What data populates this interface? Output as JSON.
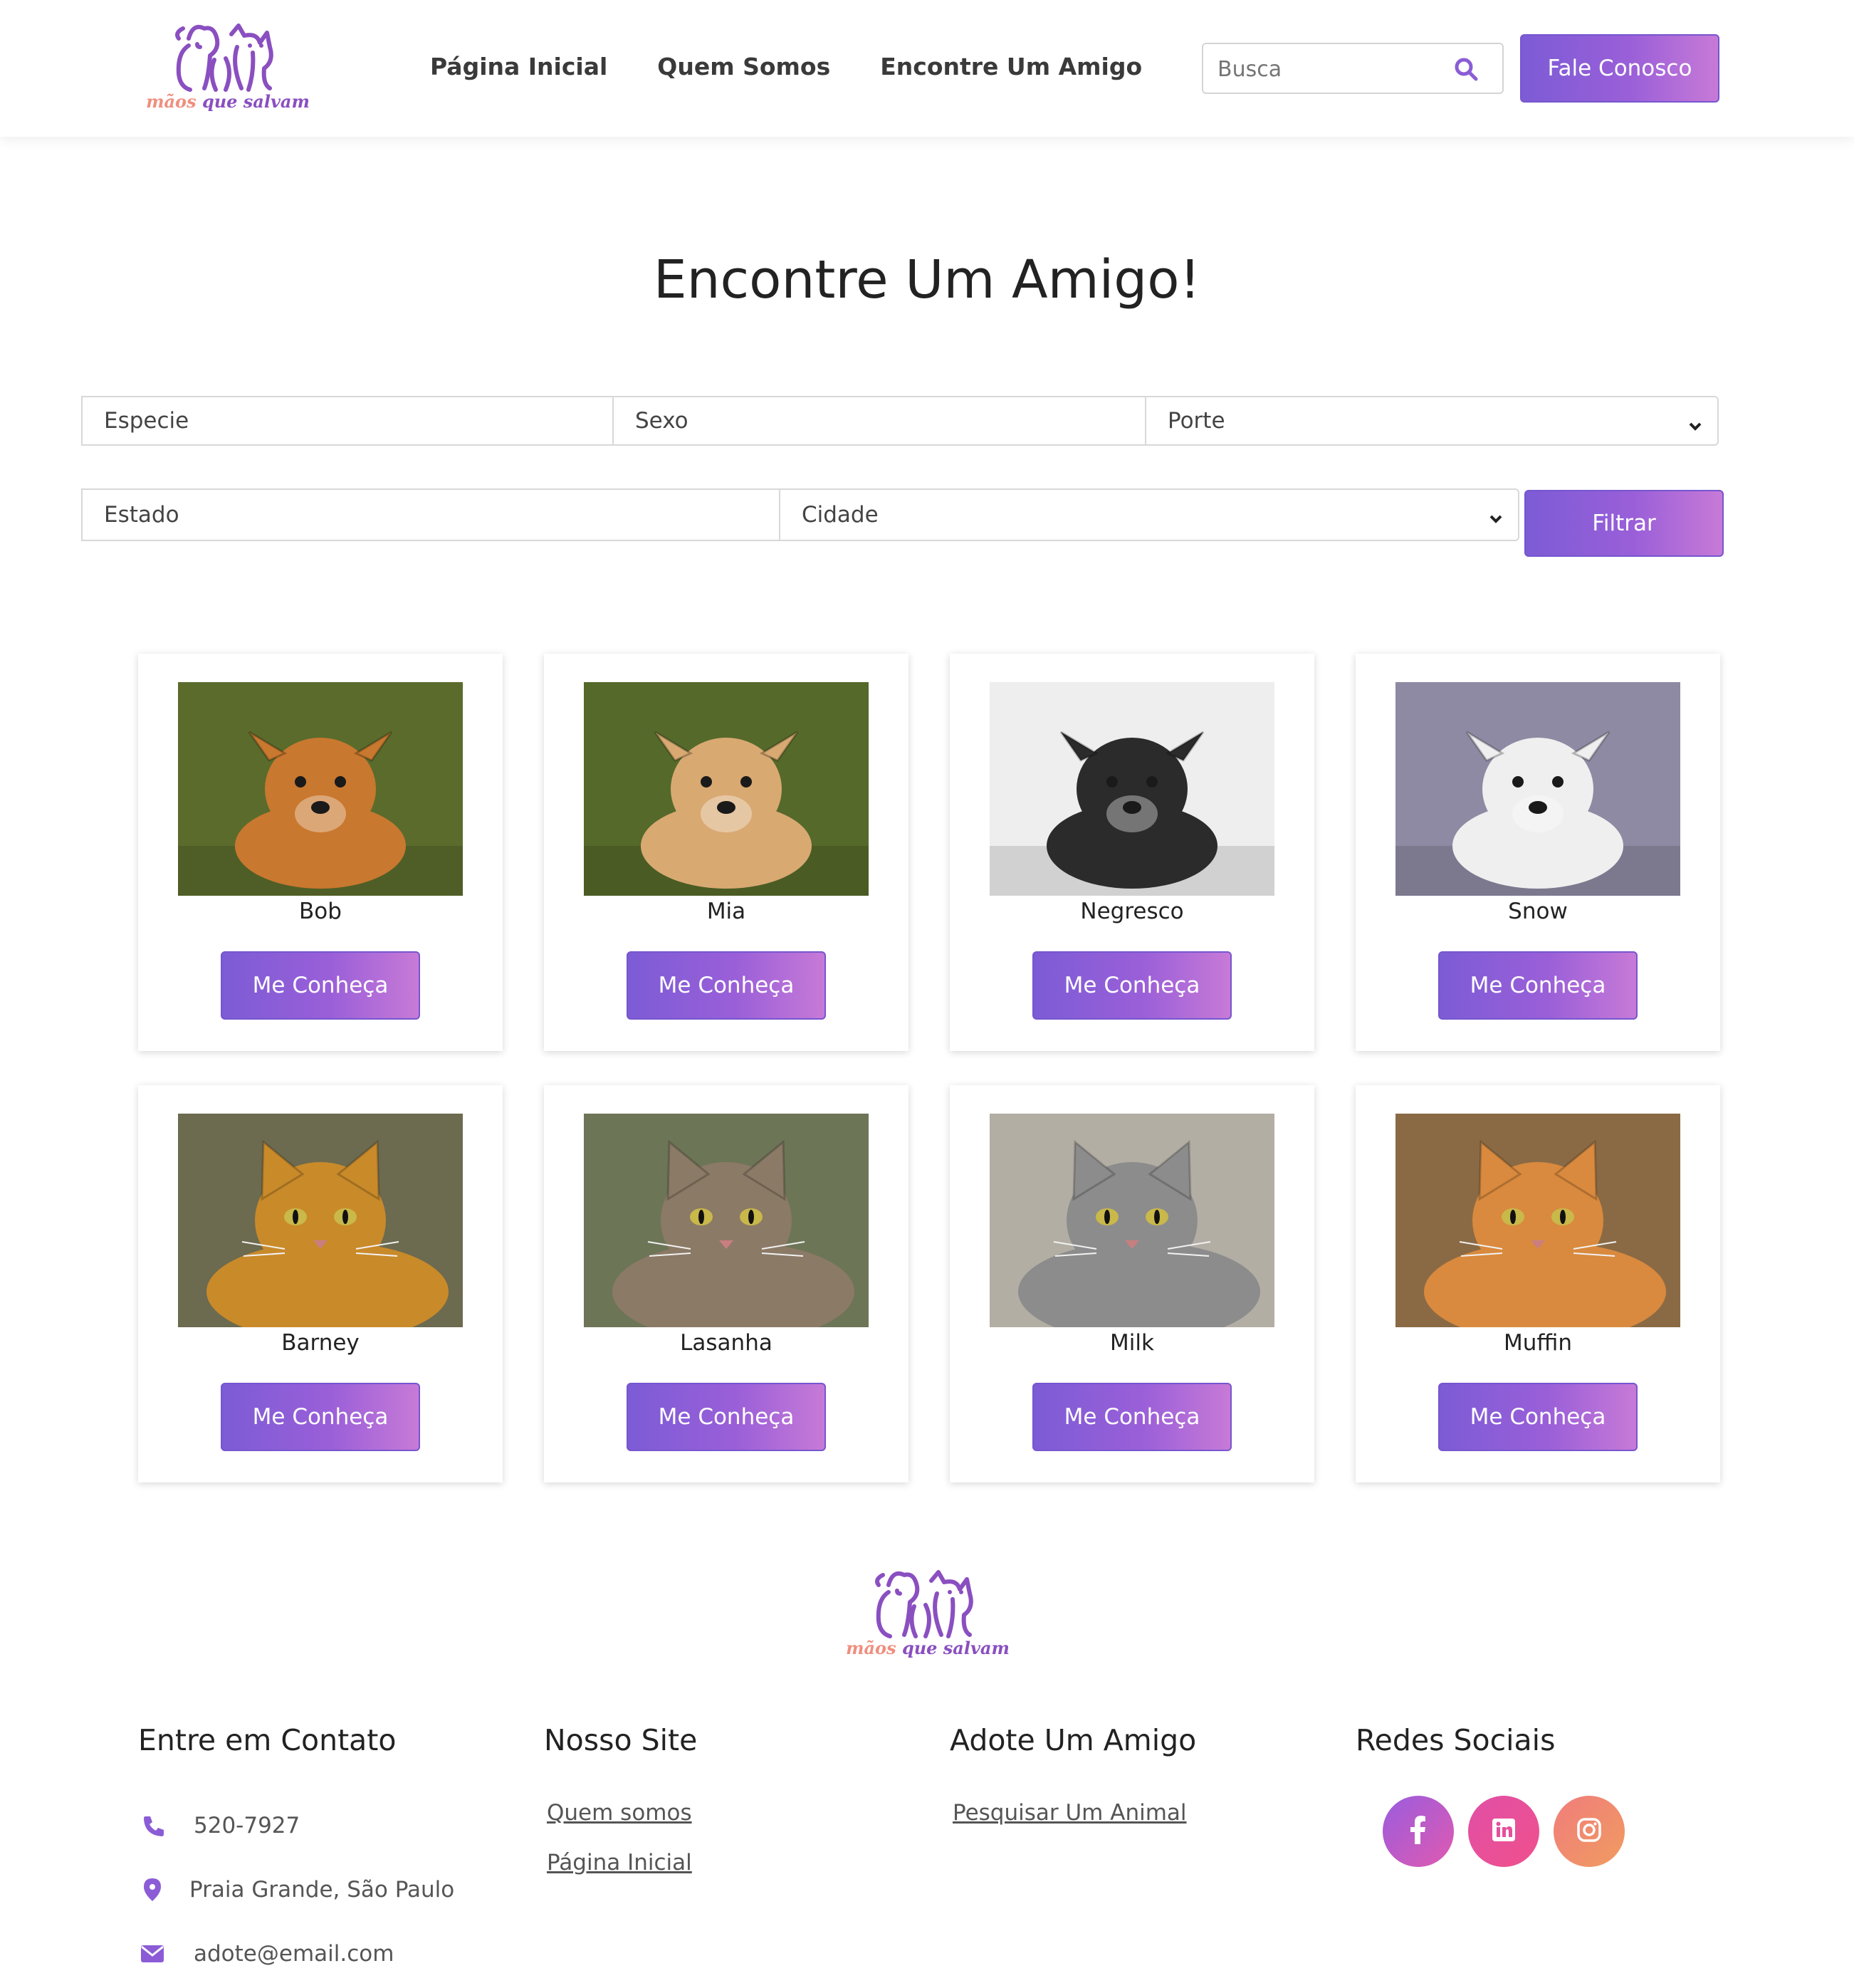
{
  "header": {
    "logo_text_a": "mãos",
    "logo_text_b": "que salvam",
    "nav": [
      "Página Inicial",
      "Quem Somos",
      "Encontre Um Amigo"
    ],
    "search_placeholder": "Busca",
    "contact_button": "Fale Conosco"
  },
  "main": {
    "title": "Encontre Um Amigo!",
    "filters": {
      "especie": "Especie",
      "sexo": "Sexo",
      "porte": "Porte",
      "estado": "Estado",
      "cidade": "Cidade",
      "filter_button": "Filtrar"
    },
    "meet_label": "Me Conheça",
    "animals": [
      {
        "name": "Bob",
        "kind": "dog",
        "bg": "#5a6b2c",
        "coat": "#c9782f"
      },
      {
        "name": "Mia",
        "kind": "dog",
        "bg": "#55692a",
        "coat": "#d9a972"
      },
      {
        "name": "Negresco",
        "kind": "dog",
        "bg": "#eeeeee",
        "coat": "#2b2b2b"
      },
      {
        "name": "Snow",
        "kind": "dog",
        "bg": "#8e8aa3",
        "coat": "#efefef"
      },
      {
        "name": "Barney",
        "kind": "cat",
        "bg": "#6c6a4f",
        "coat": "#c98a2a"
      },
      {
        "name": "Lasanha",
        "kind": "cat",
        "bg": "#6d7557",
        "coat": "#8b7a66"
      },
      {
        "name": "Milk",
        "kind": "cat",
        "bg": "#b3aea4",
        "coat": "#8c8c8c"
      },
      {
        "name": "Muffin",
        "kind": "cat",
        "bg": "#8a6a45",
        "coat": "#d98a3e"
      }
    ]
  },
  "footer": {
    "contact_title": "Entre em Contato",
    "phone": "520-7927",
    "location": "Praia Grande, São Paulo",
    "email": "adote@email.com",
    "site_title": "Nosso Site",
    "site_links": [
      "Quem somos",
      "Página Inicial"
    ],
    "adopt_title": "Adote Um Amigo",
    "adopt_link": "Pesquisar Um Animal",
    "social_title": "Redes Sociais",
    "social": [
      {
        "icon": "facebook-icon",
        "colors": [
          "#9a5cdf",
          "#e05ab0"
        ]
      },
      {
        "icon": "linkedin-icon",
        "colors": [
          "#e04fa6",
          "#f0508c"
        ]
      },
      {
        "icon": "instagram-icon",
        "colors": [
          "#f07c7c",
          "#f09c60"
        ]
      }
    ]
  },
  "colors": {
    "accent": "#8b5cd6",
    "accent_end": "#c77ad7"
  }
}
